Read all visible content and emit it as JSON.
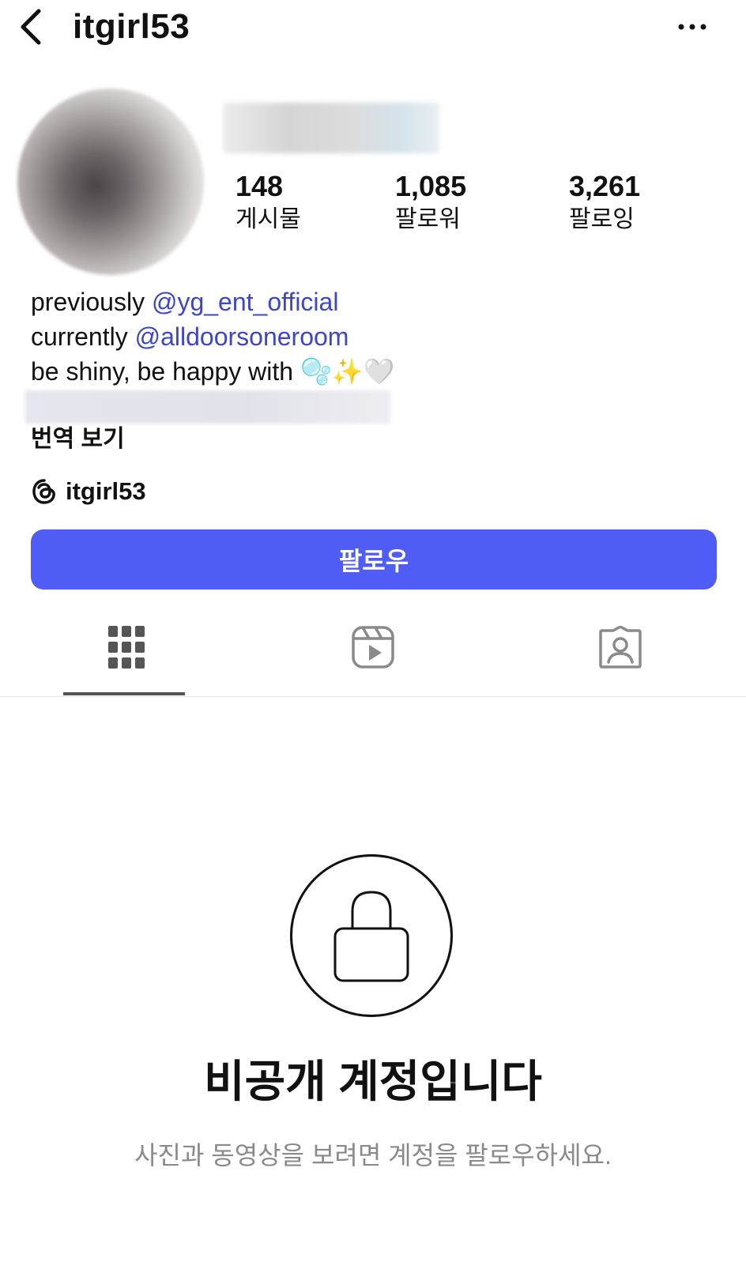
{
  "header": {
    "username": "itgirl53",
    "back_icon": "chevron-left-icon",
    "more_icon": "more-horizontal-icon"
  },
  "stats": {
    "posts": {
      "count": "148",
      "label": "게시물"
    },
    "followers": {
      "count": "1,085",
      "label": "팔로워"
    },
    "following": {
      "count": "3,261",
      "label": "팔로잉"
    }
  },
  "bio": {
    "line1_text": "previously ",
    "line1_mention": "@yg_ent_official",
    "line2_text": "currently ",
    "line2_mention": "@alldoorsoneroom",
    "line3_text": "be shiny, be happy with ",
    "line3_emoji": "🫧✨🤍"
  },
  "see_translation": "번역 보기",
  "threads": {
    "icon": "threads-icon",
    "name": "itgirl53"
  },
  "follow_button": {
    "label": "팔로우",
    "color": "#4f5df6"
  },
  "tabs": [
    {
      "icon": "grid-icon",
      "active": true
    },
    {
      "icon": "reels-icon",
      "active": false
    },
    {
      "icon": "tagged-icon",
      "active": false
    }
  ],
  "private_notice": {
    "icon": "lock-icon",
    "title": "비공개 계정입니다",
    "subtitle": "사진과 동영상을 보려면 계정을 팔로우하세요."
  }
}
